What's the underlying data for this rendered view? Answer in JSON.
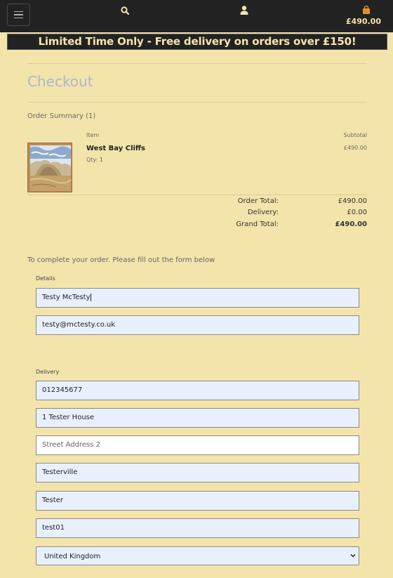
{
  "header": {
    "menu_icon": "hamburger-icon",
    "search_icon": "search-icon",
    "account_icon": "user-icon",
    "bag_icon": "shopping-bag-icon",
    "cart_total": "£490.00",
    "accent_color": "#f3e4ab"
  },
  "promo": {
    "text": "Limited Time Only - Free delivery on orders over £150!"
  },
  "page": {
    "title": "Checkout"
  },
  "summary": {
    "heading": "Order Summary (1)",
    "col_item": "Item",
    "col_subtotal": "Subtotal",
    "items": [
      {
        "name": "West Bay Cliffs",
        "qty": "Qty: 1",
        "price": "£490.00"
      }
    ],
    "totals": [
      {
        "label": "Order Total:",
        "value": "£490.00"
      },
      {
        "label": "Delivery:",
        "value": "£0.00"
      },
      {
        "label": "Grand Total:",
        "value": "£490.00"
      }
    ]
  },
  "form": {
    "instructions": "To complete your order. Please fill out the form below",
    "details_label": "Details",
    "full_name": "Testy McTesty",
    "email": "testy@mctesty.co.uk",
    "delivery_label": "Delivery",
    "phone": "012345677",
    "street1": "1 Tester House",
    "street2_placeholder": "Street Address 2",
    "town": "Testerville",
    "county": "Tester",
    "postcode": "test01",
    "country": "United Kingdom"
  }
}
